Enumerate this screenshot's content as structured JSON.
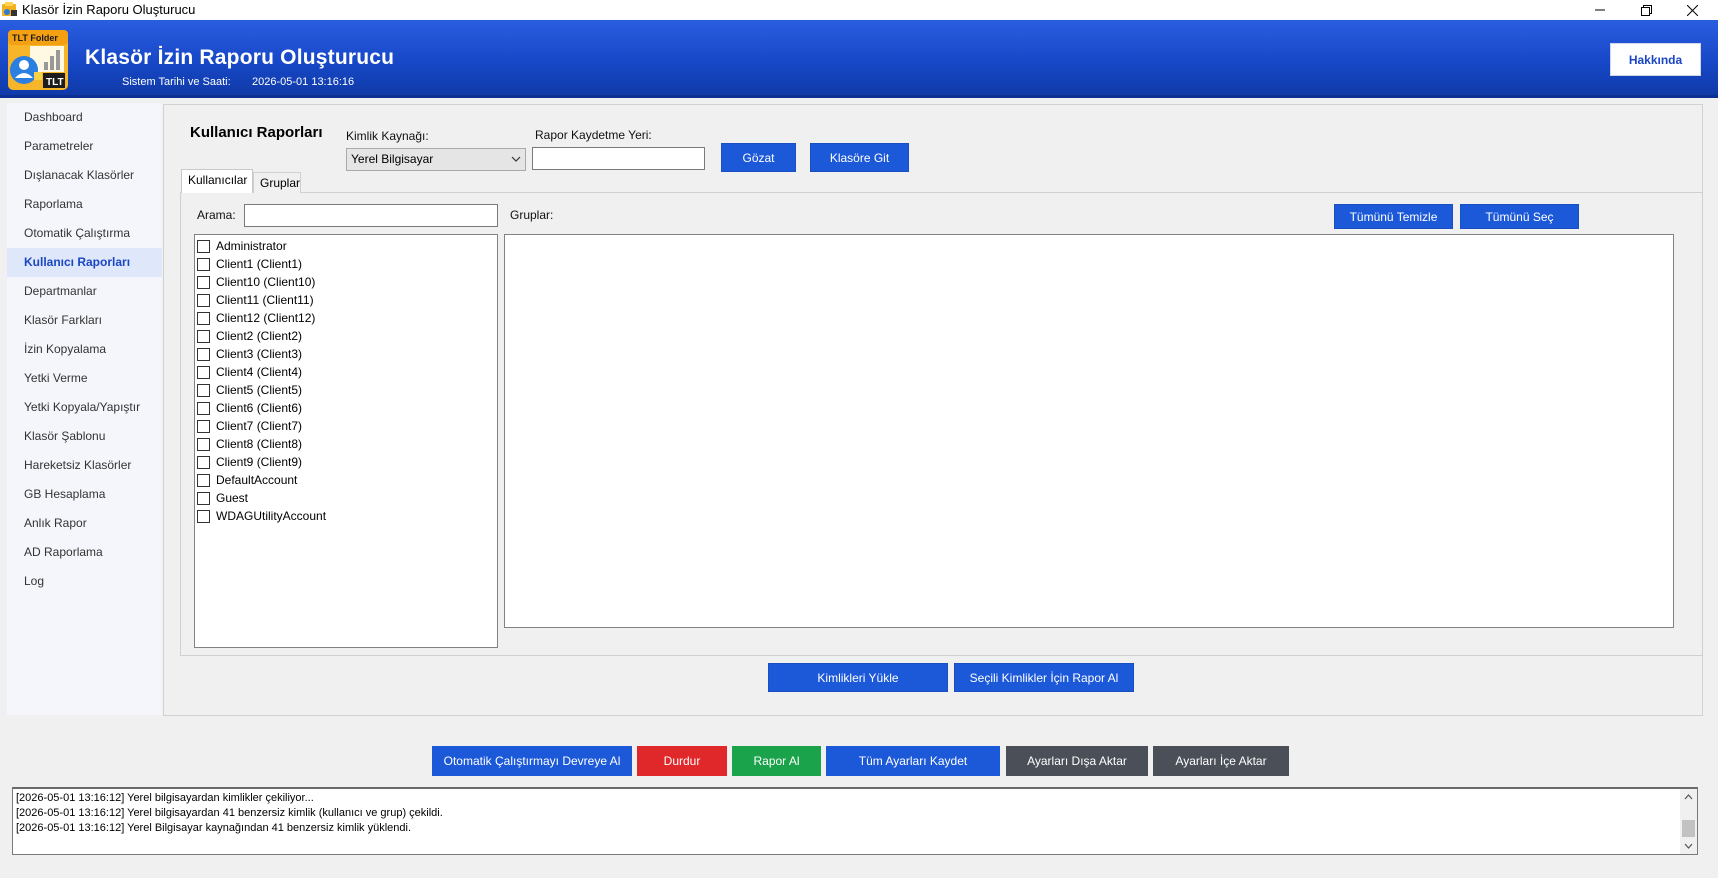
{
  "window": {
    "title": "Klasör İzin Raporu Oluşturucu"
  },
  "header": {
    "logo_text_top": "TLT Folder",
    "logo_text_badge": "TLT",
    "title": "Klasör İzin Raporu Oluşturucu",
    "datetime_label": "Sistem Tarihi ve Saati:",
    "datetime_value": "2026-05-01 13:16:16",
    "about_label": "Hakkında"
  },
  "sidebar": {
    "items": [
      {
        "label": "Dashboard"
      },
      {
        "label": "Parametreler"
      },
      {
        "label": "Dışlanacak Klasörler"
      },
      {
        "label": "Raporlama"
      },
      {
        "label": "Otomatik Çalıştırma"
      },
      {
        "label": "Kullanıcı Raporları",
        "active": true
      },
      {
        "label": "Departmanlar"
      },
      {
        "label": "Klasör Farkları"
      },
      {
        "label": "İzin Kopyalama"
      },
      {
        "label": "Yetki Verme"
      },
      {
        "label": "Yetki Kopyala/Yapıştır"
      },
      {
        "label": "Klasör Şablonu"
      },
      {
        "label": "Hareketsiz Klasörler"
      },
      {
        "label": "GB Hesaplama"
      },
      {
        "label": "Anlık Rapor"
      },
      {
        "label": "AD Raporlama"
      },
      {
        "label": "Log"
      }
    ]
  },
  "main": {
    "section_title": "Kullanıcı Raporları",
    "identity_source_label": "Kimlik Kaynağı:",
    "identity_source_value": "Yerel Bilgisayar",
    "save_location_label": "Rapor Kaydetme Yeri:",
    "save_location_value": "",
    "browse_label": "Gözat",
    "go_folder_label": "Klasöre Git",
    "tabs": [
      {
        "label": "Kullanıcılar",
        "active": true
      },
      {
        "label": "Gruplar",
        "active": false
      }
    ],
    "search_label": "Arama:",
    "search_value": "",
    "groups_label": "Gruplar:",
    "clear_all_label": "Tümünü Temizle",
    "select_all_label": "Tümünü Seç",
    "users": [
      {
        "name": "Administrator",
        "checked": false
      },
      {
        "name": "Client1 (Client1)",
        "checked": false
      },
      {
        "name": "Client10 (Client10)",
        "checked": false
      },
      {
        "name": "Client11 (Client11)",
        "checked": false
      },
      {
        "name": "Client12 (Client12)",
        "checked": false
      },
      {
        "name": "Client2 (Client2)",
        "checked": false
      },
      {
        "name": "Client3 (Client3)",
        "checked": false
      },
      {
        "name": "Client4 (Client4)",
        "checked": false
      },
      {
        "name": "Client5 (Client5)",
        "checked": false
      },
      {
        "name": "Client6 (Client6)",
        "checked": false
      },
      {
        "name": "Client7 (Client7)",
        "checked": false
      },
      {
        "name": "Client8 (Client8)",
        "checked": false
      },
      {
        "name": "Client9 (Client9)",
        "checked": false
      },
      {
        "name": "DefaultAccount",
        "checked": false
      },
      {
        "name": "Guest",
        "checked": false
      },
      {
        "name": "WDAGUtilityAccount",
        "checked": false
      }
    ],
    "load_identities_label": "Kimlikleri Yükle",
    "report_selected_label": "Seçili Kimlikler İçin Rapor Al"
  },
  "toolbar": {
    "auto_run_label": "Otomatik Çalıştırmayı Devreye Al",
    "stop_label": "Durdur",
    "report_label": "Rapor Al",
    "save_all_label": "Tüm Ayarları Kaydet",
    "export_label": "Ayarları Dışa Aktar",
    "import_label": "Ayarları İçe Aktar"
  },
  "colors": {
    "primary_blue": "#1c59d9",
    "stop_red": "#e0282a",
    "report_green": "#1aa34a",
    "dark_gray": "#4a4f58",
    "header_blue": "#1748c8"
  },
  "log": {
    "lines": [
      "[2026-05-01 13:16:12] Yerel bilgisayardan kimlikler çekiliyor...",
      "[2026-05-01 13:16:12] Yerel bilgisayardan 41 benzersiz kimlik (kullanıcı ve grup) çekildi.",
      "[2026-05-01 13:16:12] Yerel Bilgisayar kaynağından 41 benzersiz kimlik yüklendi."
    ]
  }
}
